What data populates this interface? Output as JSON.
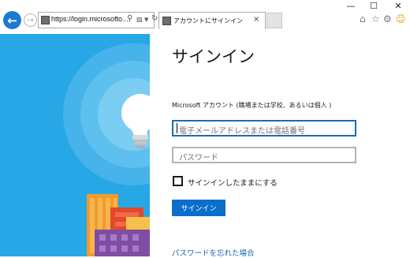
{
  "browser": {
    "address_url": "https://login.microsofto...",
    "tab_title": "アカウントにサインイン",
    "window_controls": [
      "minimize",
      "maximize",
      "close"
    ],
    "toolbar_icons": [
      "home-icon",
      "star-icon",
      "gear-icon",
      "smiley-icon"
    ]
  },
  "signin": {
    "title": "サインイン",
    "subtitle": "Microsoft アカウント (職場または学校、あるいは個人 )",
    "email_placeholder": "電子メールアドレスまたは電話番号",
    "password_placeholder": "パスワード",
    "keep_signed_in": "サインインしたままにする",
    "signin_button": "サインイン",
    "forgot_password": "パスワードを忘れた場合"
  },
  "colors": {
    "accent": "#0a6fcb",
    "illustration_bg": "#28a7e6",
    "link": "#1665b4"
  }
}
